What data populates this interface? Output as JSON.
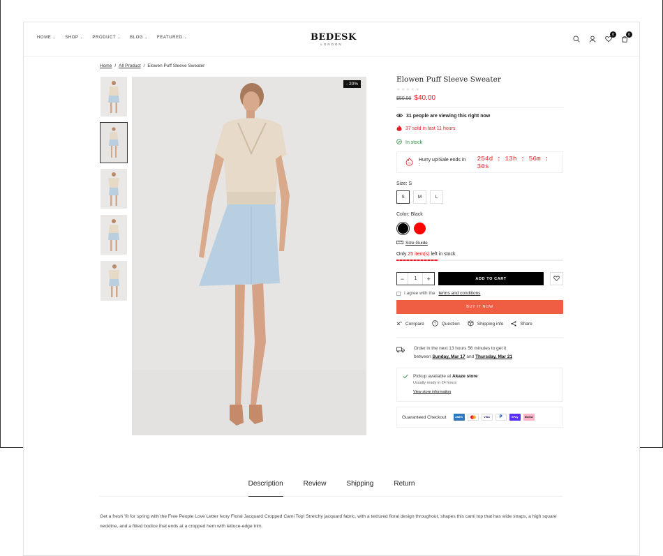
{
  "header": {
    "nav": [
      {
        "label": "HOME"
      },
      {
        "label": "SHOP"
      },
      {
        "label": "PRODUCT"
      },
      {
        "label": "BLOG"
      },
      {
        "label": "FEATURED"
      }
    ],
    "logo_main": "BEDESK",
    "logo_sub": "LONDON",
    "wishlist_count": "0",
    "cart_count": "0"
  },
  "breadcrumb": {
    "home": "Home",
    "category": "All Product",
    "current": "Elowen Puff Sleeve Sweater",
    "separator": "/"
  },
  "gallery": {
    "discount_badge": "- 20%"
  },
  "product": {
    "title": "Elowen Puff Sleeve Sweater",
    "stars": "★★★★★",
    "old_price": "$50.00",
    "new_price": "$40.00",
    "viewing": "31 people are viewing this right now",
    "sold": "37 sold in last 11 hours",
    "stock_status": "In stock",
    "hurry_label": "Hurry up!Sale ends in :",
    "timer": "254d : 13h : 56m : 30s",
    "size_label": "Size: S",
    "sizes": [
      "S",
      "M",
      "L"
    ],
    "color_label": "Color: Black",
    "colors": [
      "#000000",
      "#ff0000"
    ],
    "size_guide": "Size Guide",
    "stock_prefix": "Only",
    "stock_count": "25 item(s)",
    "stock_suffix": "left in stock",
    "stock_fraction": 0.25,
    "quantity": "1",
    "minus": "−",
    "plus": "+",
    "add_to_cart": "ADD TO CART",
    "agree_prefix": "I agree with the",
    "terms": "terms and conditions",
    "buy_now": "BUY IT NOW",
    "actions": [
      {
        "label": "Compare"
      },
      {
        "label": "Question"
      },
      {
        "label": "Shipping info"
      },
      {
        "label": "Share"
      }
    ],
    "delivery_line1": "Order in the next 13 hours 56 minutes to get it",
    "delivery_between": "between",
    "delivery_date1": "Sunday, Mar 17",
    "delivery_and": "and",
    "delivery_date2": "Thursday, Mar 21",
    "pickup_prefix": "Pickup available at",
    "pickup_store": "Akaze store",
    "pickup_ready": "Usually ready in 24 hours",
    "pickup_link": "View store information",
    "guaranteed": "Guaranteed Checkout",
    "payments": [
      {
        "label": "AMEX",
        "color": "#2e77bc"
      },
      {
        "label": "MC",
        "color": "#ffffff"
      },
      {
        "label": "VISA",
        "color": "#ffffff"
      },
      {
        "label": "P",
        "color": "#ffffff"
      },
      {
        "label": "GPay",
        "color": "#5a31f4"
      },
      {
        "label": "Klarna",
        "color": "#ffb3c7"
      }
    ]
  },
  "tabs": [
    "Description",
    "Review",
    "Shipping",
    "Return"
  ],
  "description": "Get a fresh 'fit for spring with the Free People Love Letter Ivory Floral Jacquard Cropped Cami Top! Stretchy jacquard fabric, with a textured floral design throughout, shapes this cami top that has wide straps, a high square neckline, and a fitted bodice that ends at a cropped hem with lettuce-edge trim.",
  "colors": {
    "accent_red": "#e31b23",
    "buy_now": "#ef5e43",
    "in_stock_green": "#2a8a3e"
  }
}
